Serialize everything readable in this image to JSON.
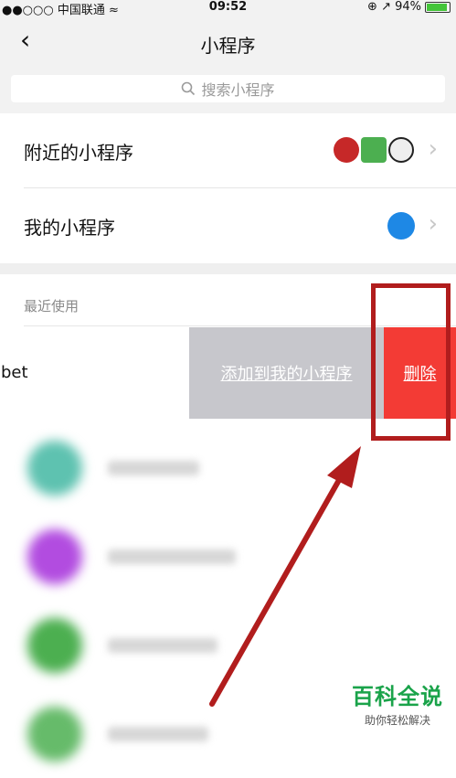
{
  "status": {
    "carrier": "●●○○○ 中国联通 ≈",
    "time": "09:52",
    "right_text": "⊕ ↗ 94%"
  },
  "nav": {
    "back_icon": "chevron-left",
    "title": "小程序"
  },
  "search": {
    "placeholder": "搜索小程序"
  },
  "rows": [
    {
      "label": "附近的小程序"
    },
    {
      "label": "我的小程序"
    }
  ],
  "recent": {
    "title": "最近使用",
    "swiped_item_text": "lbet",
    "add_label": "添加到我的小程序",
    "delete_label": "删除"
  },
  "watermark": {
    "main": "百科全说",
    "sub": "助你轻松解决"
  },
  "colors": {
    "delete": "#f33b35",
    "add": "#c7c7cc",
    "highlight": "#b11d1d",
    "watermark": "#1aa34a"
  }
}
